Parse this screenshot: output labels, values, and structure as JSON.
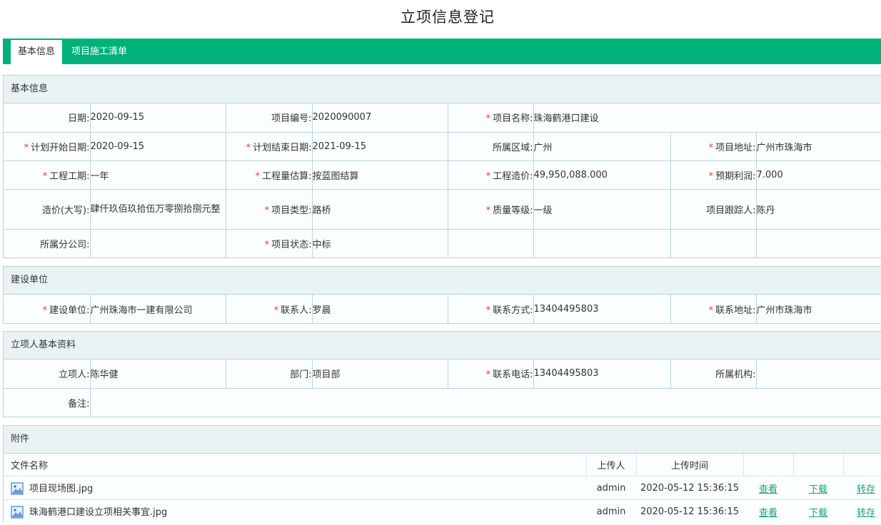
{
  "page": {
    "title": "立项信息登记"
  },
  "tabs": [
    {
      "label": "基本信息",
      "active": true
    },
    {
      "label": "项目施工清单",
      "active": false
    }
  ],
  "basic": {
    "heading": "基本信息",
    "date_label": "日期:",
    "date": "2020-09-15",
    "code_label": "项目编号:",
    "code": "2020090007",
    "name_label": "项目名称:",
    "name": "珠海鹤港口建设",
    "plan_start_label": "计划开始日期:",
    "plan_start": "2020-09-15",
    "plan_end_label": "计划结束日期:",
    "plan_end": "2021-09-15",
    "region_label": "所属区域:",
    "region": "广州",
    "address_label": "项目地址:",
    "address": "广州市珠海市",
    "period_label": "工程工期:",
    "period": "一年",
    "estimate_label": "工程量估算:",
    "estimate": "按蓝图结算",
    "cost_label": "工程造价:",
    "cost": "49,950,088.000",
    "profit_label": "预期利润:",
    "profit": "7.000",
    "cost_upper_label": "造价(大写):",
    "cost_upper": "肆仟玖佰玖拾伍万零捌拾捌元整",
    "type_label": "项目类型:",
    "type": "路桥",
    "quality_label": "质量等级:",
    "quality": "一级",
    "tracker_label": "项目跟踪人:",
    "tracker": "陈丹",
    "branch_label": "所属分公司:",
    "branch": "",
    "status_label": "项目状态:",
    "status": "中标"
  },
  "builder": {
    "heading": "建设单位",
    "unit_label": "建设单位:",
    "unit": "广州珠海市一建有限公司",
    "contact_label": "联系人:",
    "contact": "罗晨",
    "phone_label": "联系方式:",
    "phone": "13404495803",
    "address_label": "联系地址:",
    "address": "广州市珠海市"
  },
  "applicant": {
    "heading": "立项人基本资料",
    "person_label": "立项人:",
    "person": "陈华健",
    "dept_label": "部门:",
    "dept": "项目部",
    "phone_label": "联系电话:",
    "phone": "13404495803",
    "org_label": "所属机构:",
    "org": "",
    "remark_label": "备注:",
    "remark": ""
  },
  "attachments": {
    "heading": "附件",
    "col_name": "文件名称",
    "col_uploader": "上传人",
    "col_time": "上传时间",
    "files": [
      {
        "name": "项目现场图.jpg",
        "uploader": "admin",
        "time": "2020-05-12 15:36:15",
        "view": "查看",
        "download": "下载",
        "save": "转存"
      },
      {
        "name": "珠海鹤港口建设立项相关事宜.jpg",
        "uploader": "admin",
        "time": "2020-05-12 15:36:15",
        "view": "查看",
        "download": "下载",
        "save": "转存"
      }
    ]
  },
  "colors": {
    "accent": "#00b27a",
    "required": "#e53935",
    "link": "#1e9e75",
    "border": "#b5d7d5"
  }
}
